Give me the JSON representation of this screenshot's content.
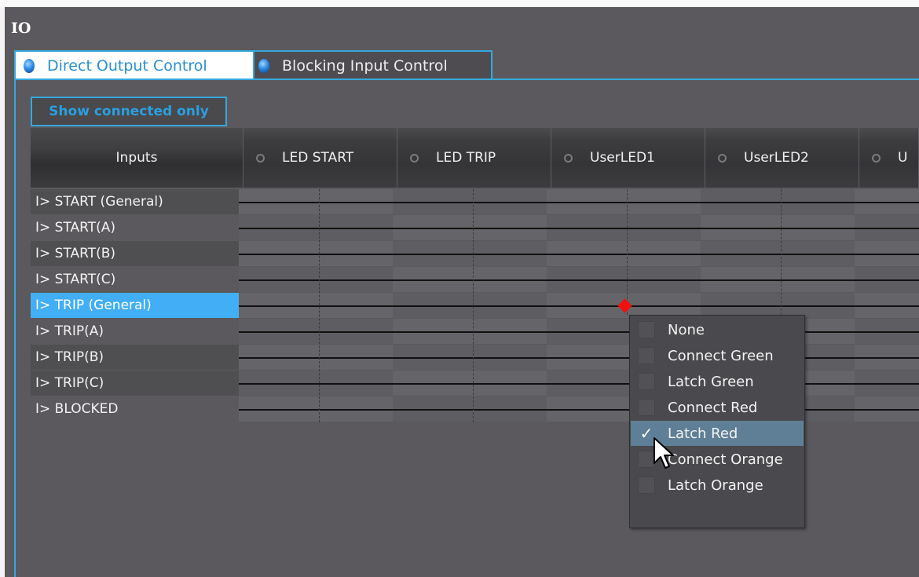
{
  "window": {
    "title": "IO"
  },
  "tabs": [
    {
      "label": "Direct Output Control",
      "active": true
    },
    {
      "label": "Blocking Input Control",
      "active": false
    }
  ],
  "toolbar": {
    "show_connected_label": "Show connected only"
  },
  "matrix": {
    "inputs_header": "Inputs",
    "columns": [
      "LED START",
      "LED TRIP",
      "UserLED1",
      "UserLED2",
      "U"
    ],
    "rows": [
      "I> START (General)",
      "I> START(A)",
      "I> START(B)",
      "I> START(C)",
      "I> TRIP (General)",
      "I> TRIP(A)",
      "I> TRIP(B)",
      "I> TRIP(C)",
      "I> BLOCKED"
    ],
    "selected_row": "I> TRIP (General)"
  },
  "context_menu": {
    "items": [
      {
        "label": "None",
        "checked": false
      },
      {
        "label": "Connect Green",
        "checked": false
      },
      {
        "label": "Latch Green",
        "checked": false
      },
      {
        "label": "Connect Red",
        "checked": false
      },
      {
        "label": "Latch Red",
        "checked": true
      },
      {
        "label": "Connect Orange",
        "checked": false
      },
      {
        "label": "Latch Orange",
        "checked": false
      }
    ],
    "check_glyph": "✓"
  },
  "colors": {
    "accent": "#35a9dd",
    "selection": "#42aef5",
    "connection_marker": "#f01010"
  },
  "icons": {
    "tab_indicator": "blue-led-icon",
    "column_led": "led-off-icon",
    "pointer": "mouse-cursor-icon"
  }
}
